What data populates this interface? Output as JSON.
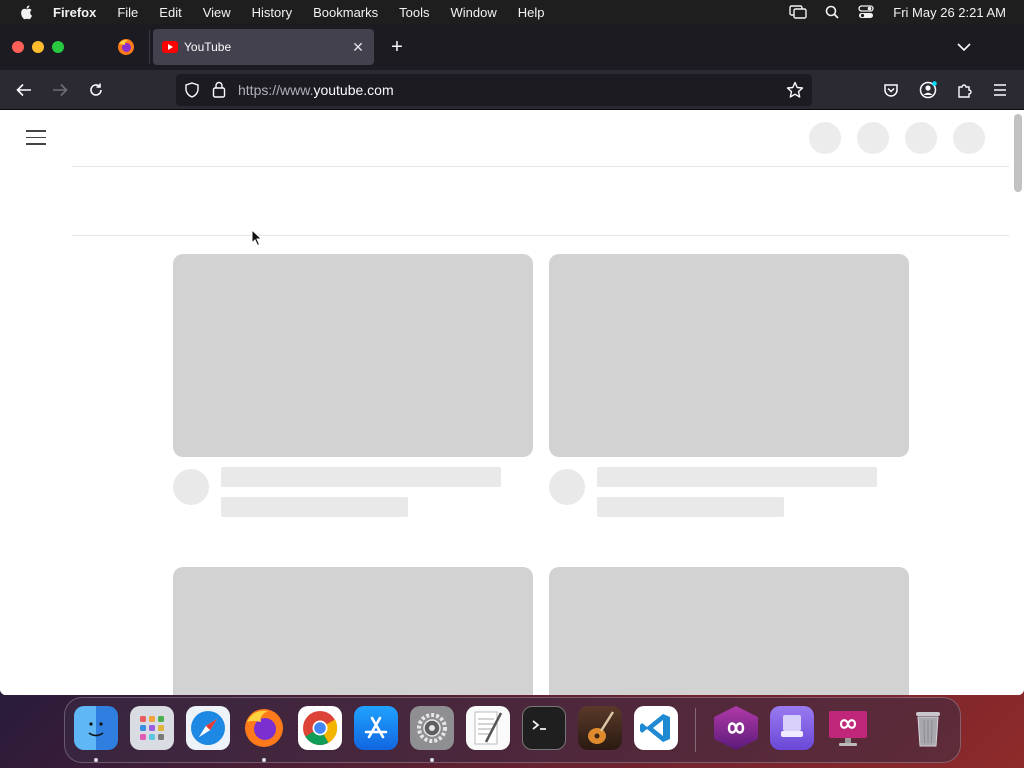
{
  "menubar": {
    "app_name": "Firefox",
    "menus": [
      "File",
      "Edit",
      "View",
      "History",
      "Bookmarks",
      "Tools",
      "Window",
      "Help"
    ],
    "clock": "Fri May 26  2:21 AM"
  },
  "browser": {
    "active_tab_title": "YouTube",
    "url_prefix": "https://www.",
    "url_domain": "youtube.com"
  },
  "colors": {
    "youtube_red": "#ff0000",
    "placeholder": "#d2d2d2",
    "toolbar": "#2b2a33",
    "tabbar": "#1c1b22"
  },
  "dock": {
    "apps": [
      "Finder",
      "Launchpad",
      "Safari",
      "Firefox",
      "Google Chrome",
      "App Store",
      "System Preferences",
      "TextEdit",
      "Terminal",
      "GarageBand",
      "Visual Studio Code",
      "Affinity App",
      "Apple Configurator",
      "Remote Desktop App",
      "Trash"
    ]
  }
}
